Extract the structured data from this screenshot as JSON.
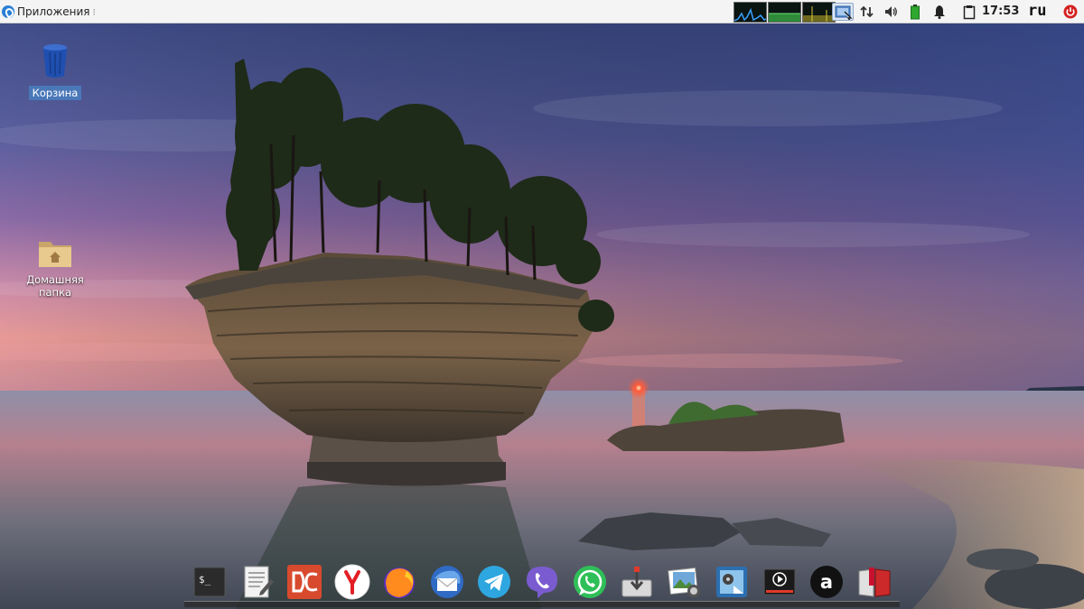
{
  "panel": {
    "apps_menu_label": "Приложения",
    "clock": "17:53",
    "keyboard_layout": "ru"
  },
  "desktop": {
    "icons": [
      {
        "label": "Корзина",
        "icon": "trash-icon",
        "selected": true
      },
      {
        "label": "Домашняя папка",
        "icon": "home-folder-icon",
        "selected": false
      }
    ]
  },
  "tray": {
    "icons": [
      "screenshot-icon",
      "network-icon",
      "volume-icon",
      "battery-icon",
      "notifications-icon",
      "clipboard-icon",
      "power-icon"
    ]
  },
  "dock": {
    "apps": [
      "terminal",
      "text-editor",
      "doublecmd",
      "yandex-browser",
      "firefox",
      "mail-client",
      "telegram",
      "viber",
      "whatsapp",
      "installer",
      "image-viewer",
      "video-editor",
      "media-player",
      "aimp",
      "book-reader"
    ]
  },
  "colors": {
    "panel_bg": "#f4f4f4",
    "selection": "#4a78b8",
    "power": "#d42020",
    "battery": "#2fa82f"
  }
}
